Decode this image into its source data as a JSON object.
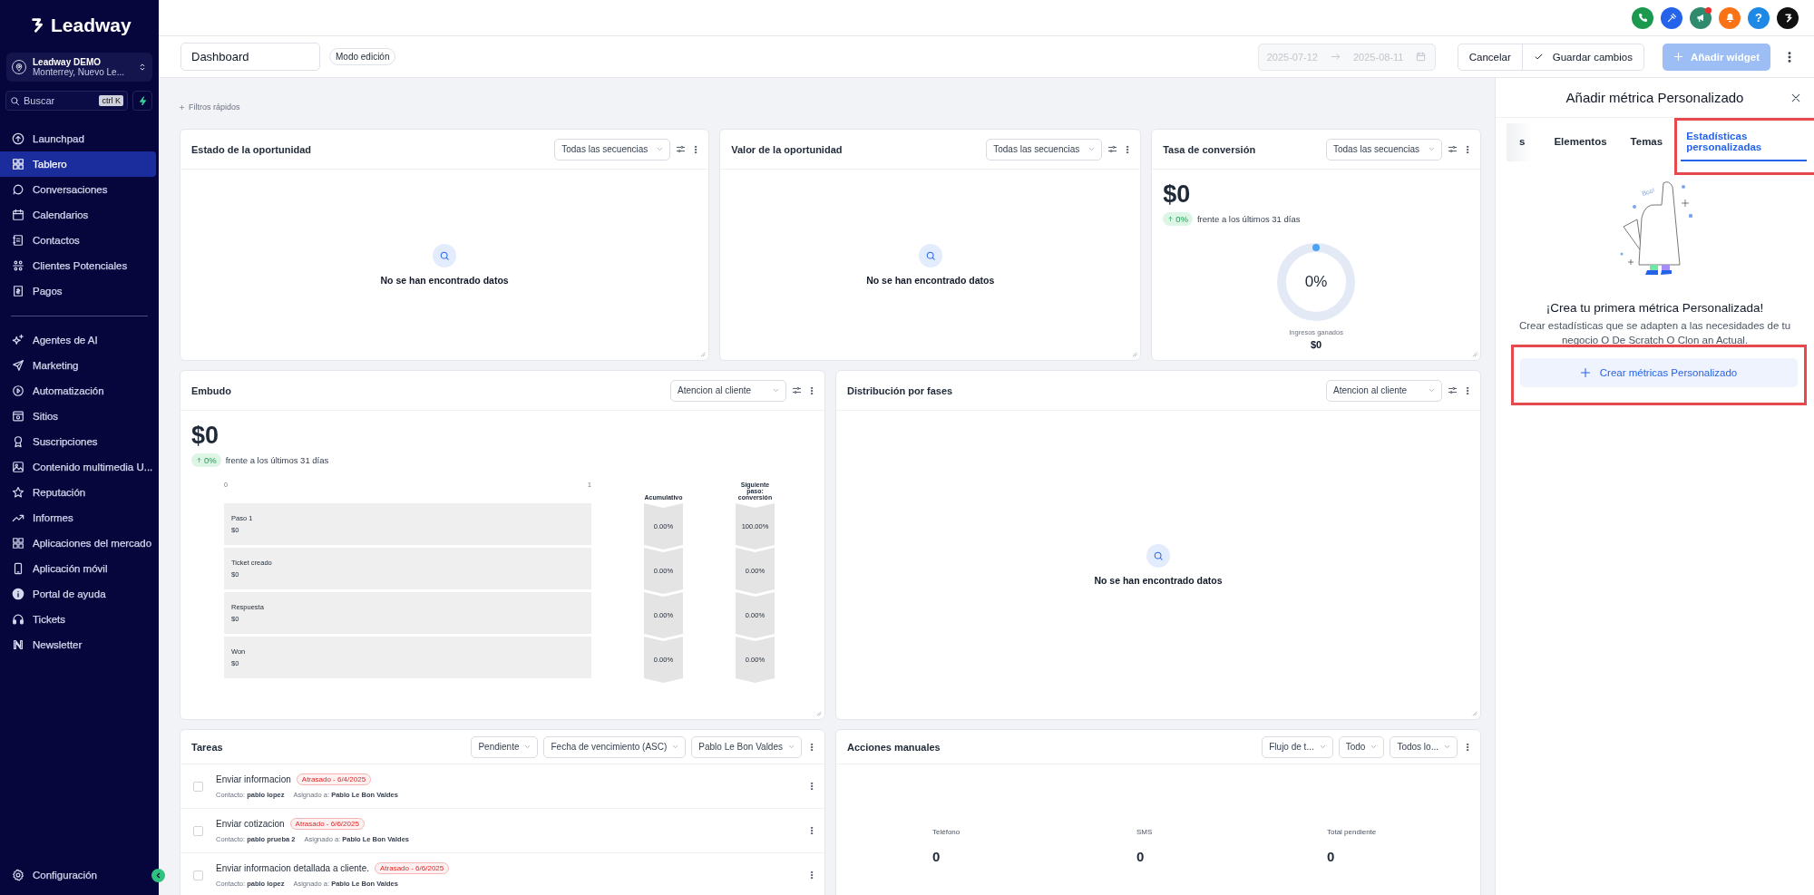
{
  "brand": "Leadway",
  "account": {
    "name": "Leadway DEMO",
    "location": "Monterrey, Nuevo Le..."
  },
  "search": {
    "placeholder": "Buscar",
    "shortcut": "ctrl K"
  },
  "nav_groups": [
    {
      "items": [
        {
          "label": "Launchpad",
          "selected": false
        },
        {
          "label": "Tablero",
          "selected": true
        },
        {
          "label": "Conversaciones",
          "selected": false
        },
        {
          "label": "Calendarios",
          "selected": false
        },
        {
          "label": "Contactos",
          "selected": false
        },
        {
          "label": "Clientes Potenciales",
          "selected": false
        },
        {
          "label": "Pagos",
          "selected": false
        }
      ]
    },
    {
      "items": [
        {
          "label": "Agentes de AI",
          "selected": false
        },
        {
          "label": "Marketing",
          "selected": false
        },
        {
          "label": "Automatización",
          "selected": false
        },
        {
          "label": "Sitios",
          "selected": false
        },
        {
          "label": "Suscripciones",
          "selected": false
        },
        {
          "label": "Contenido multimedia U...",
          "selected": false
        },
        {
          "label": "Reputación",
          "selected": false
        },
        {
          "label": "Informes",
          "selected": false
        },
        {
          "label": "Aplicaciones del mercado",
          "selected": false
        },
        {
          "label": "Aplicación móvil",
          "selected": false
        },
        {
          "label": "Portal de ayuda",
          "selected": false
        },
        {
          "label": "Tickets",
          "selected": false
        },
        {
          "label": "Newsletter",
          "selected": false
        }
      ]
    }
  ],
  "settings": {
    "label": "Configuración"
  },
  "header_icons": [
    {
      "color": "#1b9a4f",
      "badge": false
    },
    {
      "color": "#2563eb",
      "badge": false
    },
    {
      "color": "#2f8a6e",
      "badge": true
    },
    {
      "color": "#f97316",
      "badge": false
    },
    {
      "color": "#1e88e5",
      "badge": false,
      "glyph": "?"
    },
    {
      "color": "#111111",
      "badge": false
    }
  ],
  "toolbar": {
    "dashboard_name": "Dashboard",
    "mode_badge": "Modo edición",
    "date_from": "2025-07-12",
    "date_to": "2025-08-11",
    "date_disabled": true,
    "cancel": "Cancelar",
    "save": "Guardar cambios",
    "add": "Añadir widget",
    "add_disabled": true
  },
  "quick_filters": "Filtros rápidos",
  "widget_rows": [
    {
      "widgets": [
        {
          "kind": "empty",
          "title": "Estado de la oportunidad",
          "filter": "Todas las secuencias",
          "message": "No se han encontrado datos"
        },
        {
          "kind": "empty",
          "title": "Valor de la oportunidad",
          "filter": "Todas las secuencias",
          "message": "No se han encontrado datos"
        },
        {
          "kind": "conversion",
          "title": "Tasa de conversión",
          "filter": "Todas las secuencias",
          "value": "$0",
          "change": "0%",
          "comparison": "frente a los últimos 31 días",
          "gauge_label": "0%",
          "caption": "Ingresos ganados",
          "caption_value": "$0"
        }
      ]
    },
    {
      "widgets": [
        {
          "kind": "funnel",
          "title": "Embudo",
          "filter": "Atencion al cliente",
          "value": "$0",
          "change": "0%",
          "comparison": "frente a los últimos 31 días",
          "axis_min": "0",
          "axis_max": "1",
          "column_1": "Acumulativo",
          "column_2": "Siguiente paso: conversión",
          "stages": [
            {
              "name": "Paso 1",
              "value": "$0",
              "cumulative": "0.00%",
              "next": "100.00%"
            },
            {
              "name": "Ticket creado",
              "value": "$0",
              "cumulative": "0.00%",
              "next": "0.00%"
            },
            {
              "name": "Respuesta",
              "value": "$0",
              "cumulative": "0.00%",
              "next": "0.00%"
            },
            {
              "name": "Won",
              "value": "$0",
              "cumulative": "0.00%",
              "next": "0.00%"
            }
          ]
        },
        {
          "kind": "empty",
          "title": "Distribución por fases",
          "filter": "Atencion al cliente",
          "message": "No se han encontrado datos"
        }
      ]
    },
    {
      "widgets": [
        {
          "kind": "tasks",
          "title": "Tareas",
          "filters": [
            "Pendiente",
            "Fecha de vencimiento (ASC)",
            "Pablo Le Bon Valdes"
          ],
          "tasks": [
            {
              "title": "Enviar informacion",
              "badge": "Atrasado - 6/4/2025",
              "contact": "Contacto: **pablo lopez**",
              "assigned": "Asignado a: **Pablo Le Bon Valdes**",
              "checked": false
            },
            {
              "title": "Enviar cotizacion",
              "badge": "Atrasado - 6/6/2025",
              "contact": "Contacto: **pablo prueba 2**",
              "assigned": "Asignado a: **Pablo Le Bon Valdes**",
              "checked": false
            },
            {
              "title": "Enviar informacion detallada a cliente.",
              "badge": "Atrasado - 6/6/2025",
              "contact": "Contacto: **pablo lopez**",
              "assigned": "Asignado a: **Pablo Le Bon Valdes**",
              "checked": false
            }
          ]
        },
        {
          "kind": "manual",
          "title": "Acciones manuales",
          "filters": [
            "Flujo de t...",
            "Todo",
            "Todos lo..."
          ],
          "stats": [
            {
              "label": "Teléfono",
              "value": "0"
            },
            {
              "label": "SMS",
              "value": "0"
            },
            {
              "label": "Total pendiente",
              "value": "0"
            }
          ]
        }
      ]
    }
  ],
  "panel": {
    "title": "Añadir métrica Personalizado",
    "tabs": [
      {
        "label": "s",
        "selected": false,
        "highlighted": false
      },
      {
        "label": "Elementos",
        "selected": false,
        "highlighted": false
      },
      {
        "label": "Temas",
        "selected": false,
        "highlighted": false
      },
      {
        "label": "Estadísticas personalizadas",
        "selected": true,
        "highlighted": true
      }
    ],
    "illustration_text": "Boo!",
    "heading": "¡Crea tu primera métrica Personalizada!",
    "description": "Crear estadísticas que se adapten a las necesidades de tu negocio O De Scratch O Clon an Actual.",
    "button": "Crear métricas Personalizado",
    "button_highlighted": true
  }
}
